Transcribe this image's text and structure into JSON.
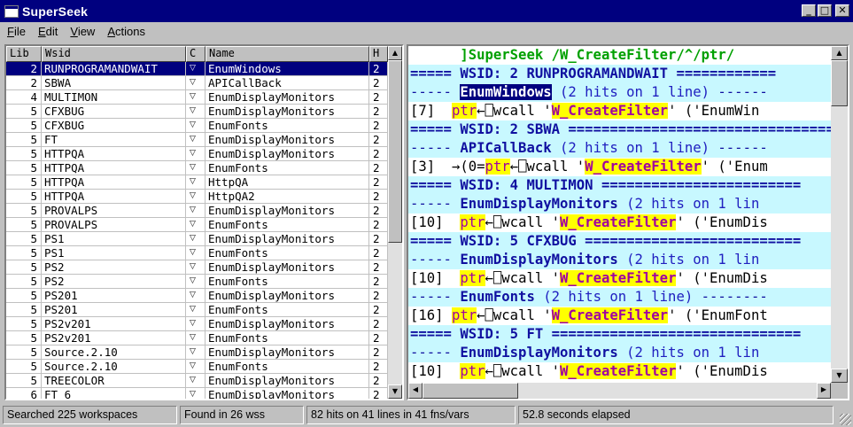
{
  "window": {
    "title": "SuperSeek"
  },
  "menu": [
    {
      "label": "File",
      "accel": "F",
      "rest": "ile"
    },
    {
      "label": "Edit",
      "accel": "E",
      "rest": "dit"
    },
    {
      "label": "View",
      "accel": "V",
      "rest": "iew"
    },
    {
      "label": "Actions",
      "accel": "A",
      "rest": "ctions"
    }
  ],
  "grid": {
    "columns": [
      "Lib",
      "Wsid",
      "C",
      "Name",
      "H"
    ],
    "rows": [
      {
        "lib": "2",
        "wsid": "RUNPROGRAMANDWAIT",
        "c": "▽",
        "name": "EnumWindows",
        "h": "2",
        "selected": true
      },
      {
        "lib": "2",
        "wsid": "SBWA",
        "c": "▽",
        "name": "APICallBack",
        "h": "2"
      },
      {
        "lib": "4",
        "wsid": "MULTIMON",
        "c": "▽",
        "name": "EnumDisplayMonitors",
        "h": "2"
      },
      {
        "lib": "5",
        "wsid": "CFXBUG",
        "c": "▽",
        "name": "EnumDisplayMonitors",
        "h": "2"
      },
      {
        "lib": "5",
        "wsid": "CFXBUG",
        "c": "▽",
        "name": "EnumFonts",
        "h": "2"
      },
      {
        "lib": "5",
        "wsid": "FT",
        "c": "▽",
        "name": "EnumDisplayMonitors",
        "h": "2"
      },
      {
        "lib": "5",
        "wsid": "HTTPQA",
        "c": "▽",
        "name": "EnumDisplayMonitors",
        "h": "2"
      },
      {
        "lib": "5",
        "wsid": "HTTPQA",
        "c": "▽",
        "name": "EnumFonts",
        "h": "2"
      },
      {
        "lib": "5",
        "wsid": "HTTPQA",
        "c": "▽",
        "name": "HttpQA",
        "h": "2"
      },
      {
        "lib": "5",
        "wsid": "HTTPQA",
        "c": "▽",
        "name": "HttpQA2",
        "h": "2"
      },
      {
        "lib": "5",
        "wsid": "PROVALPS",
        "c": "▽",
        "name": "EnumDisplayMonitors",
        "h": "2"
      },
      {
        "lib": "5",
        "wsid": "PROVALPS",
        "c": "▽",
        "name": "EnumFonts",
        "h": "2"
      },
      {
        "lib": "5",
        "wsid": "PS1",
        "c": "▽",
        "name": "EnumDisplayMonitors",
        "h": "2"
      },
      {
        "lib": "5",
        "wsid": "PS1",
        "c": "▽",
        "name": "EnumFonts",
        "h": "2"
      },
      {
        "lib": "5",
        "wsid": "PS2",
        "c": "▽",
        "name": "EnumDisplayMonitors",
        "h": "2"
      },
      {
        "lib": "5",
        "wsid": "PS2",
        "c": "▽",
        "name": "EnumFonts",
        "h": "2"
      },
      {
        "lib": "5",
        "wsid": "PS201",
        "c": "▽",
        "name": "EnumDisplayMonitors",
        "h": "2"
      },
      {
        "lib": "5",
        "wsid": "PS201",
        "c": "▽",
        "name": "EnumFonts",
        "h": "2"
      },
      {
        "lib": "5",
        "wsid": "PS2v201",
        "c": "▽",
        "name": "EnumDisplayMonitors",
        "h": "2"
      },
      {
        "lib": "5",
        "wsid": "PS2v201",
        "c": "▽",
        "name": "EnumFonts",
        "h": "2"
      },
      {
        "lib": "5",
        "wsid": "Source.2.10",
        "c": "▽",
        "name": "EnumDisplayMonitors",
        "h": "2"
      },
      {
        "lib": "5",
        "wsid": "Source.2.10",
        "c": "▽",
        "name": "EnumFonts",
        "h": "2"
      },
      {
        "lib": "5",
        "wsid": "TREECOLOR",
        "c": "▽",
        "name": "EnumDisplayMonitors",
        "h": "2"
      },
      {
        "lib": "6",
        "wsid": "FT_6",
        "c": "▽",
        "name": "EnumDisplayMonitors",
        "h": "2"
      }
    ]
  },
  "results": {
    "header": "]SuperSeek /W_CreateFilter/^/ptr/",
    "search": "W_CreateFilter",
    "groups": [
      {
        "ws_prefix": "===== WSID: ",
        "lib": "2",
        "wsid": "RUNPROGRAMANDWAIT",
        "ws_suffix": " ============",
        "fns": [
          {
            "name": "EnumWindows",
            "count": "(2 hits on 1 line)",
            "tail": " ------",
            "selected": true,
            "line_no": "[7]",
            "pre": "  ",
            "ptr": "ptr",
            "mid": "←⎕wcall '",
            "post": "' ('EnumWin"
          }
        ]
      },
      {
        "ws_prefix": "===== WSID: ",
        "lib": "2",
        "wsid": "SBWA",
        "ws_suffix": " ====================================",
        "fns": [
          {
            "name": "APICallBack",
            "count": "(2 hits on 1 line)",
            "tail": " ------",
            "line_no": "[3]",
            "pre": "  →(0=",
            "ptr": "ptr",
            "mid": "←⎕wcall '",
            "post": "' ('Enum"
          }
        ]
      },
      {
        "ws_prefix": "===== WSID: ",
        "lib": "4",
        "wsid": "MULTIMON",
        "ws_suffix": " ========================",
        "fns": [
          {
            "name": "EnumDisplayMonitors",
            "count": "(2 hits on 1 lin",
            "tail": "",
            "line_no": "[10]",
            "pre": "  ",
            "ptr": "ptr",
            "mid": "←⎕wcall '",
            "post": "' ('EnumDis"
          }
        ]
      },
      {
        "ws_prefix": "===== WSID: ",
        "lib": "5",
        "wsid": "CFXBUG",
        "ws_suffix": " ==========================",
        "fns": [
          {
            "name": "EnumDisplayMonitors",
            "count": "(2 hits on 1 lin",
            "tail": "",
            "line_no": "[10]",
            "pre": "  ",
            "ptr": "ptr",
            "mid": "←⎕wcall '",
            "post": "' ('EnumDis"
          },
          {
            "name": "EnumFonts",
            "count": "(2 hits on 1 line)",
            "tail": " --------",
            "line_no": "[16]",
            "pre": " ",
            "ptr": "ptr",
            "mid": "←⎕wcall '",
            "post": "' ('EnumFont"
          }
        ]
      },
      {
        "ws_prefix": "===== WSID: ",
        "lib": "5",
        "wsid": "FT",
        "ws_suffix": " ==============================",
        "fns": [
          {
            "name": "EnumDisplayMonitors",
            "count": "(2 hits on 1 lin",
            "tail": "",
            "line_no": "[10]",
            "pre": "  ",
            "ptr": "ptr",
            "mid": "←⎕wcall '",
            "post": "' ('EnumDis"
          }
        ]
      }
    ]
  },
  "status": [
    "Searched 225 workspaces",
    "Found in 26 wss",
    "82 hits on 41 lines in 41 fns/vars",
    "52.8 seconds elapsed"
  ]
}
